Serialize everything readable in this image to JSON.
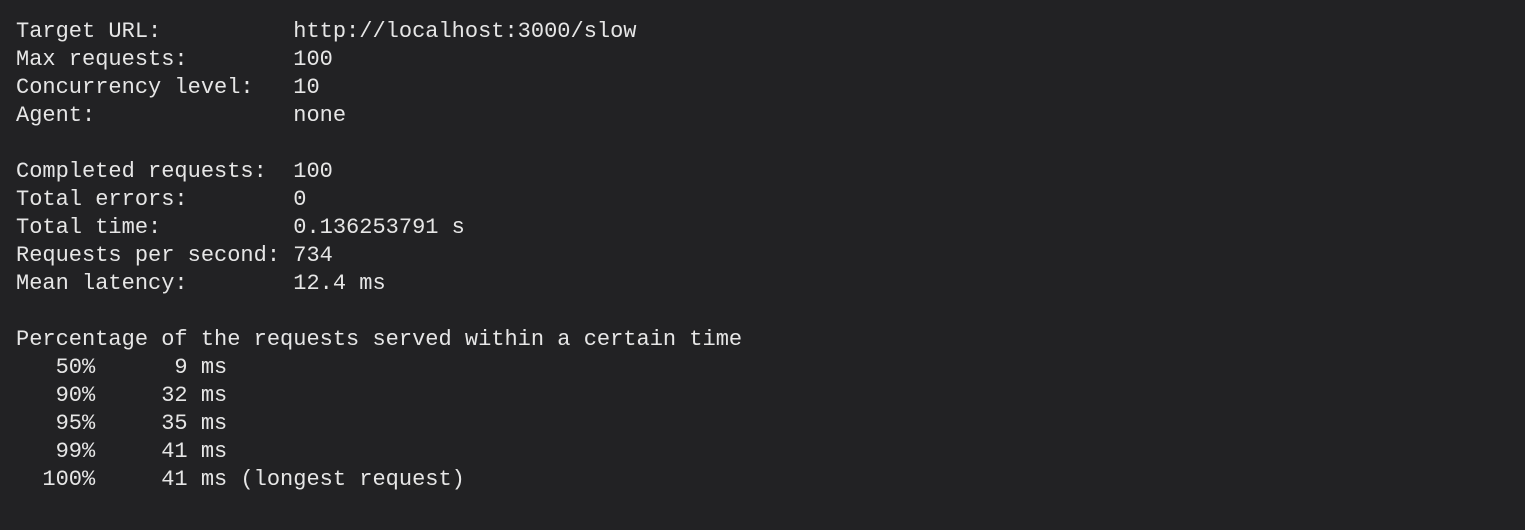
{
  "config": [
    {
      "label": "Target URL:",
      "value": "http://localhost:3000/slow"
    },
    {
      "label": "Max requests:",
      "value": "100"
    },
    {
      "label": "Concurrency level:",
      "value": "10"
    },
    {
      "label": "Agent:",
      "value": "none"
    }
  ],
  "results": [
    {
      "label": "Completed requests:",
      "value": "100"
    },
    {
      "label": "Total errors:",
      "value": "0"
    },
    {
      "label": "Total time:",
      "value": "0.136253791 s"
    },
    {
      "label": "Requests per second:",
      "value": "734"
    },
    {
      "label": "Mean latency:",
      "value": "12.4 ms"
    }
  ],
  "percentiles_header": "Percentage of the requests served within a certain time",
  "percentiles": [
    {
      "pct": "50%",
      "value": "9",
      "unit": "ms",
      "note": ""
    },
    {
      "pct": "90%",
      "value": "32",
      "unit": "ms",
      "note": ""
    },
    {
      "pct": "95%",
      "value": "35",
      "unit": "ms",
      "note": ""
    },
    {
      "pct": "99%",
      "value": "41",
      "unit": "ms",
      "note": ""
    },
    {
      "pct": "100%",
      "value": "41",
      "unit": "ms",
      "note": "(longest request)"
    }
  ]
}
